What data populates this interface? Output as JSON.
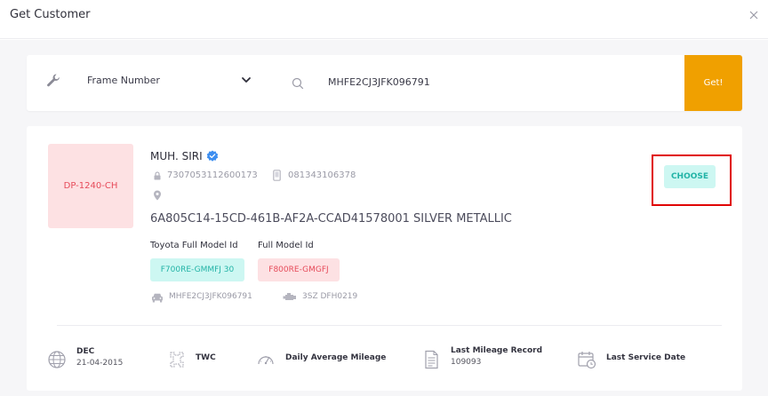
{
  "modal": {
    "title": "Get Customer",
    "close_icon": "close-icon"
  },
  "search": {
    "field_icon": "wrench-icon",
    "field_type": "Frame Number",
    "dropdown_icon": "chevron-down-icon",
    "search_icon": "search-icon",
    "value": "MHFE2CJ3JFK096791",
    "button_label": "Get!"
  },
  "customer": {
    "plate": "DP-1240-CH",
    "name": "MUH. SIRI",
    "verified_icon": "verified-badge-icon",
    "id_number": "7307053112600173",
    "phone": "081343106378",
    "address": "",
    "vehicle_description": "6A805C14-15CD-461B-AF2A-CCAD41578001 SILVER METALLIC",
    "toyota_model_label": "Toyota Full Model Id",
    "toyota_model_value": "F700RE-GMMFJ 30",
    "full_model_label": "Full Model Id",
    "full_model_value": "F800RE-GMGFJ",
    "frame_number": "MHFE2CJ3JFK096791",
    "engine_number": "3SZ DFH0219",
    "choose_label": "CHOOSE"
  },
  "stats": [
    {
      "icon": "globe-icon",
      "label": "DEC",
      "value": "21-04-2015"
    },
    {
      "icon": "twc-icon",
      "label": "TWC",
      "value": ""
    },
    {
      "icon": "speedometer-icon",
      "label": "Daily Average Mileage",
      "value": ""
    },
    {
      "icon": "document-icon",
      "label": "Last Mileage Record",
      "value": "109093"
    },
    {
      "icon": "calendar-icon",
      "label": "Last Service Date",
      "value": ""
    }
  ],
  "colors": {
    "accent": "#f0a000",
    "teal_bg": "#cdf7f2",
    "teal_text": "#22b3a6",
    "pink_bg": "#fde1e3",
    "pink_text": "#e64b5a",
    "highlight": "#e00000"
  }
}
